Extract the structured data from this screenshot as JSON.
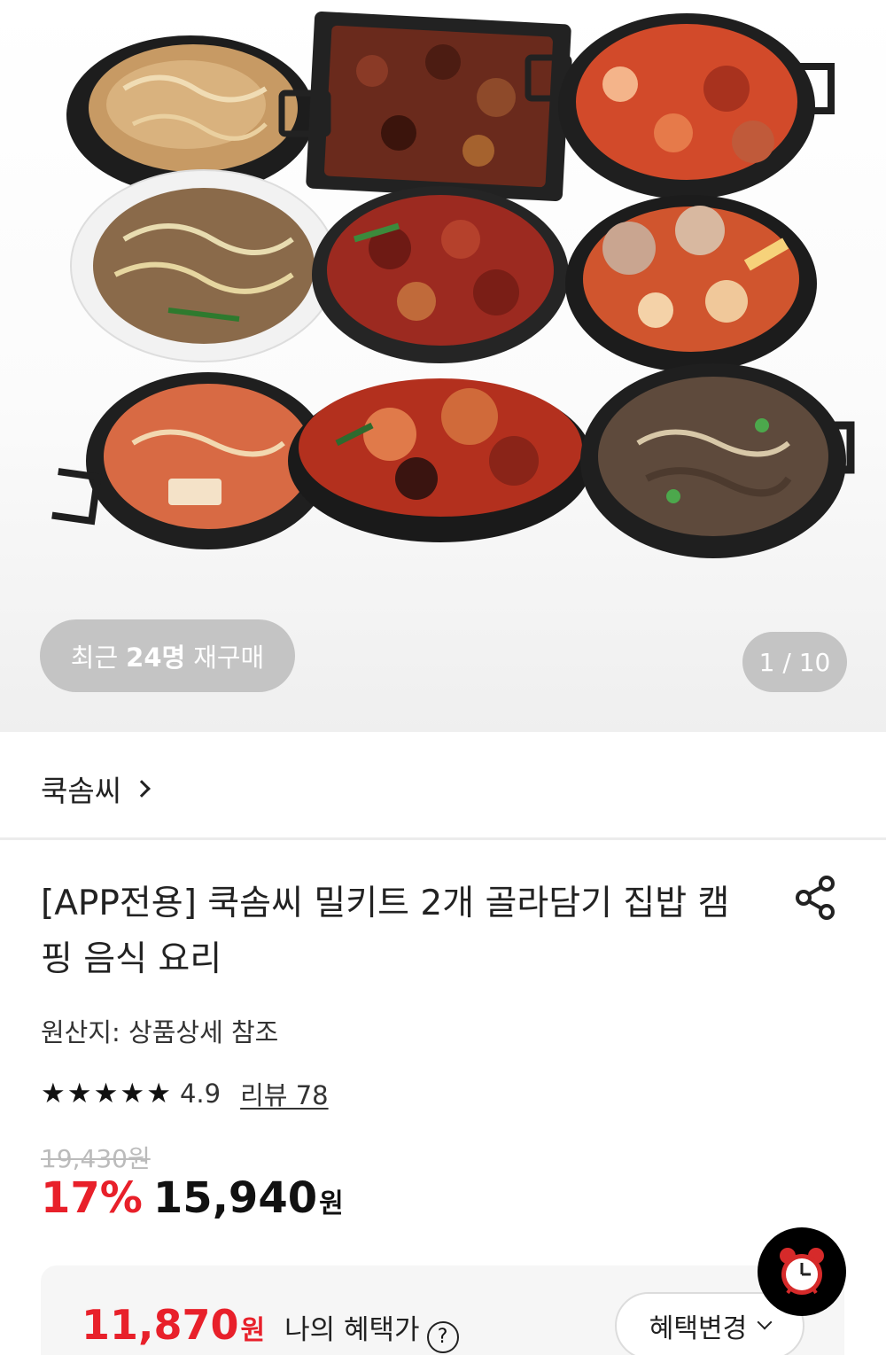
{
  "hero": {
    "image_alt": "쿡솜씨 밀키트 9종 요리 사진",
    "repurchase": {
      "prefix": "최근",
      "count": "24명",
      "suffix": "재구매"
    },
    "page_indicator": "1 / 10"
  },
  "brand": {
    "name": "쿡솜씨"
  },
  "product": {
    "title": "[APP전용] 쿡솜씨 밀키트 2개 골라담기 집밥 캠핑 음식 요리",
    "origin": "원산지: 상품상세 참조",
    "rating": {
      "stars": 5,
      "value": "4.9",
      "review_label": "리뷰 78"
    },
    "original_price": "19,430원",
    "discount": "17%",
    "price": "15,940",
    "price_unit": "원"
  },
  "benefit": {
    "price": "11,870",
    "price_unit": "원",
    "label": "나의 혜택가",
    "help_glyph": "?",
    "change_label": "혜택변경"
  },
  "icons": {
    "chevron_right": "chevron-right-icon",
    "share": "share-icon",
    "star": "star-icon",
    "help": "question-circle-icon",
    "chevron_down": "chevron-down-icon",
    "alarm": "alarm-clock-icon"
  },
  "colors": {
    "accent_red": "#e8202a",
    "pill_gray": "#c4c4c4",
    "strike_gray": "#bbbbbb",
    "alarm_red": "#d62a2a"
  }
}
